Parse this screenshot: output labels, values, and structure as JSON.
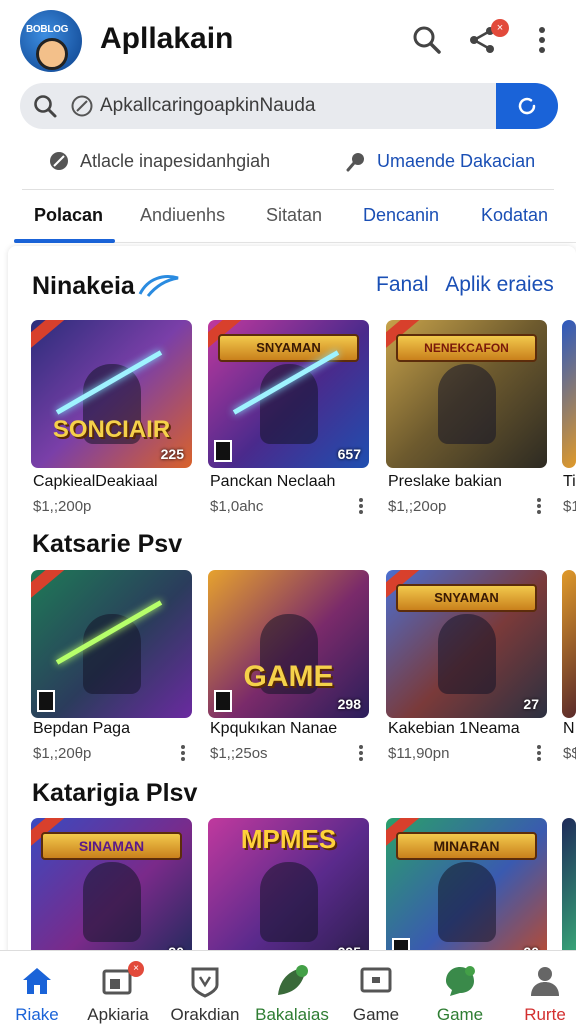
{
  "header": {
    "logo_text": "BOBLOG",
    "app_title": "Apllakain",
    "icons": [
      "search-icon",
      "share-icon",
      "more-vert-icon"
    ],
    "share_badge": "×"
  },
  "search": {
    "placeholder": "ApkallcaringoapkinNauda"
  },
  "suggestions": [
    {
      "label": "Atlacle inapesidanhgiah",
      "icon": "pencil-icon"
    },
    {
      "label": "Umaende Dakacian",
      "icon": "pin-icon"
    }
  ],
  "tabs": [
    {
      "label": "Polacan",
      "active": true
    },
    {
      "label": "Andiuenhs"
    },
    {
      "label": "Sitatan"
    },
    {
      "label": "Dencanin"
    },
    {
      "label": "Kodatan"
    }
  ],
  "sections": [
    {
      "title": "Ninakeia",
      "links": [
        "Fanal",
        "Aplik eraies"
      ],
      "items": [
        {
          "name": "CapkiealDeakiaal",
          "price": "$1,;200p",
          "rating": "225",
          "banner_text": "SONCIAIR"
        },
        {
          "name": "Panckan Neclaah",
          "price": "$1,0ahc",
          "rating": "657",
          "banner_text": "SNYAMAN"
        },
        {
          "name": "Preslake bakian",
          "price": "$1,;20op",
          "rating": "",
          "banner_text": "NENEKCAFON"
        },
        {
          "name": "Ti",
          "price": "$1",
          "rating": ""
        }
      ]
    },
    {
      "title": "Katsarie Psv",
      "items": [
        {
          "name": "Bepdan Paga",
          "price": "$1,;20θp",
          "rating": ""
        },
        {
          "name": "Kpqukıkan Nanae",
          "price": "$1,;25os",
          "rating": "298",
          "banner_text": "GAME"
        },
        {
          "name": "Kakebian 1Neama",
          "price": "$11,90pn",
          "rating": "27",
          "banner_text": "SNYAMAN"
        },
        {
          "name": "Nı",
          "price": "$$"
        }
      ]
    },
    {
      "title": "Katarigia Plsv",
      "items": [
        {
          "name": "",
          "price": "",
          "rating": "30",
          "banner_text": "SINAMAN"
        },
        {
          "name": "",
          "price": "",
          "rating": "295",
          "banner_text": "MPMES"
        },
        {
          "name": "",
          "price": "",
          "rating": "20",
          "banner_text": "MINARAN"
        }
      ]
    }
  ],
  "bottom_nav": [
    {
      "label": "Riake",
      "icon": "home-icon",
      "color": "#1a63d8",
      "active": true
    },
    {
      "label": "Apkiaria",
      "icon": "apps-icon",
      "badge": "×"
    },
    {
      "label": "Orakdian",
      "icon": "shield-icon"
    },
    {
      "label": "Bakalaias",
      "icon": "leaf-icon",
      "color": "#2e7d32"
    },
    {
      "label": "Game",
      "icon": "tv-icon"
    },
    {
      "label": "Game",
      "icon": "chat-icon",
      "color": "#2e7d32"
    },
    {
      "label": "Rurte",
      "icon": "person-icon",
      "color": "#d32f2f"
    }
  ],
  "colors": {
    "accent": "#1a63d8",
    "link": "#1a4fb5",
    "badge": "#e24a3b"
  }
}
